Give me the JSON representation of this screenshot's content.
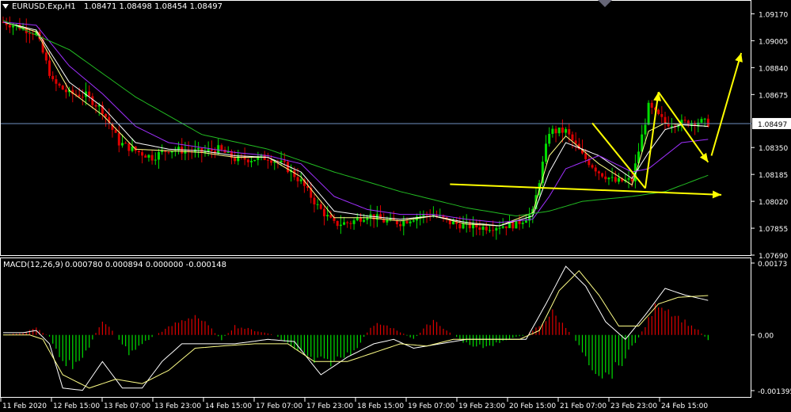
{
  "window": {
    "title": "EURUSD.Exp,H1",
    "ohlc": "1.08471 1.08498 1.08454 1.08497"
  },
  "indicator": {
    "title": "MACD(12,26,9)",
    "values": "0.000780 0.000894 0.000000 -0.000148"
  },
  "price_scale": {
    "ticks": [
      "1.09170",
      "1.09005",
      "1.08840",
      "1.08675",
      "1.08497",
      "1.08350",
      "1.08185",
      "1.08020",
      "1.07855",
      "1.07690"
    ],
    "current_label": "1.08497"
  },
  "macd_scale": {
    "ticks": [
      "0.00173",
      "0.00",
      "-0.001395"
    ]
  },
  "time_axis": {
    "labels": [
      "11 Feb 2020",
      "12 Feb 15:00",
      "13 Feb 07:00",
      "13 Feb 23:00",
      "14 Feb 15:00",
      "17 Feb 07:00",
      "17 Feb 23:00",
      "18 Feb 15:00",
      "19 Feb 07:00",
      "19 Feb 23:00",
      "20 Feb 15:00",
      "21 Feb 07:00",
      "23 Feb 23:00",
      "24 Feb 15:00"
    ]
  },
  "colors": {
    "background": "#000000",
    "frame": "#ffffff",
    "bull": "#00dd00",
    "bear": "#dd0000",
    "ma_fast": "#ffff88",
    "ma_mid": "#ffffff",
    "ma_slow": "#a030ff",
    "ma_long": "#22bb22",
    "annotation": "#ffff00",
    "current_line": "#6f8fbf"
  },
  "chart_data": [
    {
      "type": "candlestick",
      "symbol": "EURUSD",
      "timeframe": "H1",
      "ylim": [
        1.0769,
        1.0925
      ],
      "current_price": 1.08497,
      "close_path": [
        [
          0,
          1.0912
        ],
        [
          5,
          1.0909
        ],
        [
          10,
          1.0905
        ],
        [
          15,
          1.0875
        ],
        [
          20,
          1.0868
        ],
        [
          25,
          1.0867
        ],
        [
          30,
          1.0858
        ],
        [
          35,
          1.0838
        ],
        [
          40,
          1.0833
        ],
        [
          45,
          1.0829
        ],
        [
          50,
          1.0834
        ],
        [
          55,
          1.0833
        ],
        [
          60,
          1.0832
        ],
        [
          65,
          1.0834
        ],
        [
          70,
          1.0828
        ],
        [
          75,
          1.0828
        ],
        [
          80,
          1.0829
        ],
        [
          85,
          1.0824
        ],
        [
          90,
          1.0814
        ],
        [
          95,
          1.0799
        ],
        [
          100,
          1.0788
        ],
        [
          105,
          1.0789
        ],
        [
          110,
          1.0794
        ],
        [
          115,
          1.079
        ],
        [
          120,
          1.0789
        ],
        [
          125,
          1.0793
        ],
        [
          130,
          1.0794
        ],
        [
          135,
          1.0789
        ],
        [
          140,
          1.0787
        ],
        [
          145,
          1.0786
        ],
        [
          150,
          1.0787
        ],
        [
          155,
          1.0788
        ],
        [
          160,
          1.0795
        ],
        [
          165,
          1.0845
        ],
        [
          170,
          1.0845
        ],
        [
          175,
          1.083
        ],
        [
          180,
          1.082
        ],
        [
          185,
          1.0814
        ],
        [
          190,
          1.0815
        ],
        [
          195,
          1.086
        ],
        [
          200,
          1.085
        ],
        [
          205,
          1.085
        ],
        [
          210,
          1.0851
        ],
        [
          213,
          1.085
        ]
      ],
      "moving_averages": [
        {
          "key": "ma_fast",
          "path": [
            [
              0,
              1.0912
            ],
            [
              10,
              1.0906
            ],
            [
              20,
              1.087
            ],
            [
              30,
              1.0855
            ],
            [
              40,
              1.0834
            ],
            [
              50,
              1.0833
            ],
            [
              60,
              1.0832
            ],
            [
              70,
              1.0829
            ],
            [
              80,
              1.0829
            ],
            [
              90,
              1.0817
            ],
            [
              100,
              1.0792
            ],
            [
              110,
              1.0792
            ],
            [
              120,
              1.079
            ],
            [
              130,
              1.0793
            ],
            [
              140,
              1.0788
            ],
            [
              150,
              1.0787
            ],
            [
              160,
              1.0795
            ],
            [
              165,
              1.083
            ],
            [
              170,
              1.0842
            ],
            [
              180,
              1.0825
            ],
            [
              190,
              1.0812
            ],
            [
              195,
              1.0845
            ],
            [
              200,
              1.085
            ],
            [
              205,
              1.0849
            ],
            [
              213,
              1.0848
            ]
          ]
        },
        {
          "key": "ma_mid",
          "path": [
            [
              0,
              1.0912
            ],
            [
              10,
              1.0907
            ],
            [
              20,
              1.0875
            ],
            [
              30,
              1.086
            ],
            [
              40,
              1.0838
            ],
            [
              50,
              1.0834
            ],
            [
              60,
              1.0833
            ],
            [
              70,
              1.083
            ],
            [
              80,
              1.0829
            ],
            [
              90,
              1.082
            ],
            [
              100,
              1.0796
            ],
            [
              110,
              1.0793
            ],
            [
              120,
              1.0791
            ],
            [
              130,
              1.0793
            ],
            [
              140,
              1.0789
            ],
            [
              150,
              1.0787
            ],
            [
              160,
              1.0793
            ],
            [
              165,
              1.082
            ],
            [
              170,
              1.0838
            ],
            [
              180,
              1.083
            ],
            [
              190,
              1.0816
            ],
            [
              195,
              1.0832
            ],
            [
              200,
              1.0846
            ],
            [
              205,
              1.0849
            ],
            [
              213,
              1.0848
            ]
          ]
        },
        {
          "key": "ma_slow",
          "path": [
            [
              0,
              1.0912
            ],
            [
              10,
              1.091
            ],
            [
              20,
              1.0885
            ],
            [
              30,
              1.0868
            ],
            [
              40,
              1.0848
            ],
            [
              50,
              1.0838
            ],
            [
              60,
              1.0835
            ],
            [
              70,
              1.0832
            ],
            [
              80,
              1.083
            ],
            [
              90,
              1.0825
            ],
            [
              100,
              1.0805
            ],
            [
              110,
              1.0797
            ],
            [
              120,
              1.0794
            ],
            [
              130,
              1.0794
            ],
            [
              140,
              1.0791
            ],
            [
              150,
              1.0789
            ],
            [
              160,
              1.0791
            ],
            [
              165,
              1.0805
            ],
            [
              170,
              1.0822
            ],
            [
              180,
              1.083
            ],
            [
              190,
              1.082
            ],
            [
              195,
              1.0822
            ],
            [
              200,
              1.083
            ],
            [
              205,
              1.0838
            ],
            [
              213,
              1.084
            ]
          ]
        },
        {
          "key": "ma_long",
          "path": [
            [
              0,
              1.0913
            ],
            [
              20,
              1.0895
            ],
            [
              40,
              1.0866
            ],
            [
              60,
              1.0843
            ],
            [
              80,
              1.0834
            ],
            [
              100,
              1.082
            ],
            [
              120,
              1.0808
            ],
            [
              140,
              1.0798
            ],
            [
              155,
              1.0793
            ],
            [
              165,
              1.0796
            ],
            [
              175,
              1.0802
            ],
            [
              190,
              1.0805
            ],
            [
              200,
              1.0808
            ],
            [
              213,
              1.0818
            ]
          ]
        }
      ],
      "annotations": [
        {
          "kind": "trendline",
          "from": [
            135,
            1.08125
          ],
          "to": [
            217,
            1.0806
          ],
          "arrow": true
        },
        {
          "kind": "trendline",
          "from": [
            178,
            1.085
          ],
          "to": [
            194,
            1.081
          ],
          "arrow": false
        },
        {
          "kind": "trendline",
          "from": [
            194,
            1.081
          ],
          "to": [
            198,
            1.0869
          ],
          "arrow": true
        },
        {
          "kind": "trendline",
          "from": [
            198,
            1.0869
          ],
          "to": [
            213,
            1.0826
          ],
          "arrow": true
        },
        {
          "kind": "trendline",
          "from": [
            214,
            1.083
          ],
          "to": [
            223,
            1.0893
          ],
          "arrow": true
        }
      ]
    },
    {
      "type": "histogram",
      "indicator": "MACD(12,26,9)",
      "ylim": [
        -0.0014,
        0.00173
      ],
      "histogram_path": [
        [
          0,
          0.0
        ],
        [
          6,
          5e-05
        ],
        [
          10,
          0.00015
        ],
        [
          14,
          -4e-05
        ],
        [
          18,
          -0.00055
        ],
        [
          22,
          -0.00075
        ],
        [
          26,
          -0.00025
        ],
        [
          30,
          0.00035
        ],
        [
          34,
          0.0
        ],
        [
          38,
          -0.0004
        ],
        [
          42,
          -0.0002
        ],
        [
          46,
          0.0
        ],
        [
          52,
          0.00025
        ],
        [
          58,
          0.00045
        ],
        [
          62,
          0.0002
        ],
        [
          66,
          -0.0001
        ],
        [
          70,
          0.0002
        ],
        [
          76,
          0.0001
        ],
        [
          82,
          0.0
        ],
        [
          88,
          -0.0003
        ],
        [
          94,
          -0.0006
        ],
        [
          100,
          -0.0006
        ],
        [
          106,
          -0.00035
        ],
        [
          112,
          0.00025
        ],
        [
          118,
          0.00015
        ],
        [
          124,
          -0.0001
        ],
        [
          130,
          0.00035
        ],
        [
          134,
          0.0001
        ],
        [
          140,
          -0.0002
        ],
        [
          146,
          -0.0003
        ],
        [
          152,
          -0.0001
        ],
        [
          158,
          0.0
        ],
        [
          162,
          0.0002
        ],
        [
          166,
          0.0005
        ],
        [
          172,
          0.0
        ],
        [
          178,
          -0.0007
        ],
        [
          182,
          -0.00095
        ],
        [
          186,
          -0.0007
        ],
        [
          190,
          -0.0003
        ],
        [
          194,
          0.0002
        ],
        [
          198,
          0.00075
        ],
        [
          204,
          0.0004
        ],
        [
          210,
          0.0001
        ],
        [
          213,
          -0.0001
        ]
      ],
      "macd_path": [
        [
          0,
          5e-05
        ],
        [
          6,
          5e-05
        ],
        [
          10,
          0.0001
        ],
        [
          14,
          -0.0002
        ],
        [
          18,
          -0.0012
        ],
        [
          24,
          -0.00125
        ],
        [
          30,
          -0.0006
        ],
        [
          36,
          -0.0012
        ],
        [
          42,
          -0.0012
        ],
        [
          48,
          -0.0006
        ],
        [
          54,
          -0.0002
        ],
        [
          62,
          -0.0002
        ],
        [
          70,
          -0.0002
        ],
        [
          80,
          -0.0001
        ],
        [
          88,
          -0.00015
        ],
        [
          96,
          -0.0009
        ],
        [
          104,
          -0.0005
        ],
        [
          112,
          -0.0002
        ],
        [
          118,
          -0.0001
        ],
        [
          124,
          -0.0003
        ],
        [
          132,
          -0.0002
        ],
        [
          140,
          -0.0001
        ],
        [
          150,
          -0.0001
        ],
        [
          158,
          -0.0001
        ],
        [
          164,
          0.0007
        ],
        [
          170,
          0.00155
        ],
        [
          176,
          0.0011
        ],
        [
          182,
          0.0003
        ],
        [
          188,
          -0.0001
        ],
        [
          194,
          0.00045
        ],
        [
          200,
          0.00105
        ],
        [
          206,
          0.0009
        ],
        [
          213,
          0.00078
        ]
      ],
      "signal_path": [
        [
          0,
          0.0
        ],
        [
          8,
          0.0
        ],
        [
          12,
          -0.0001
        ],
        [
          18,
          -0.0009
        ],
        [
          26,
          -0.0012
        ],
        [
          34,
          -0.001
        ],
        [
          42,
          -0.0011
        ],
        [
          50,
          -0.0008
        ],
        [
          58,
          -0.0003
        ],
        [
          66,
          -0.00025
        ],
        [
          76,
          -0.0002
        ],
        [
          86,
          -0.0002
        ],
        [
          94,
          -0.0006
        ],
        [
          104,
          -0.0006
        ],
        [
          112,
          -0.0004
        ],
        [
          120,
          -0.0002
        ],
        [
          128,
          -0.00025
        ],
        [
          136,
          -0.0001
        ],
        [
          146,
          -0.0001
        ],
        [
          156,
          -0.0001
        ],
        [
          162,
          0.0001
        ],
        [
          168,
          0.001
        ],
        [
          174,
          0.00145
        ],
        [
          180,
          0.0009
        ],
        [
          186,
          0.0002
        ],
        [
          192,
          0.0002
        ],
        [
          198,
          0.0007
        ],
        [
          204,
          0.00085
        ],
        [
          213,
          0.00089
        ]
      ]
    }
  ]
}
